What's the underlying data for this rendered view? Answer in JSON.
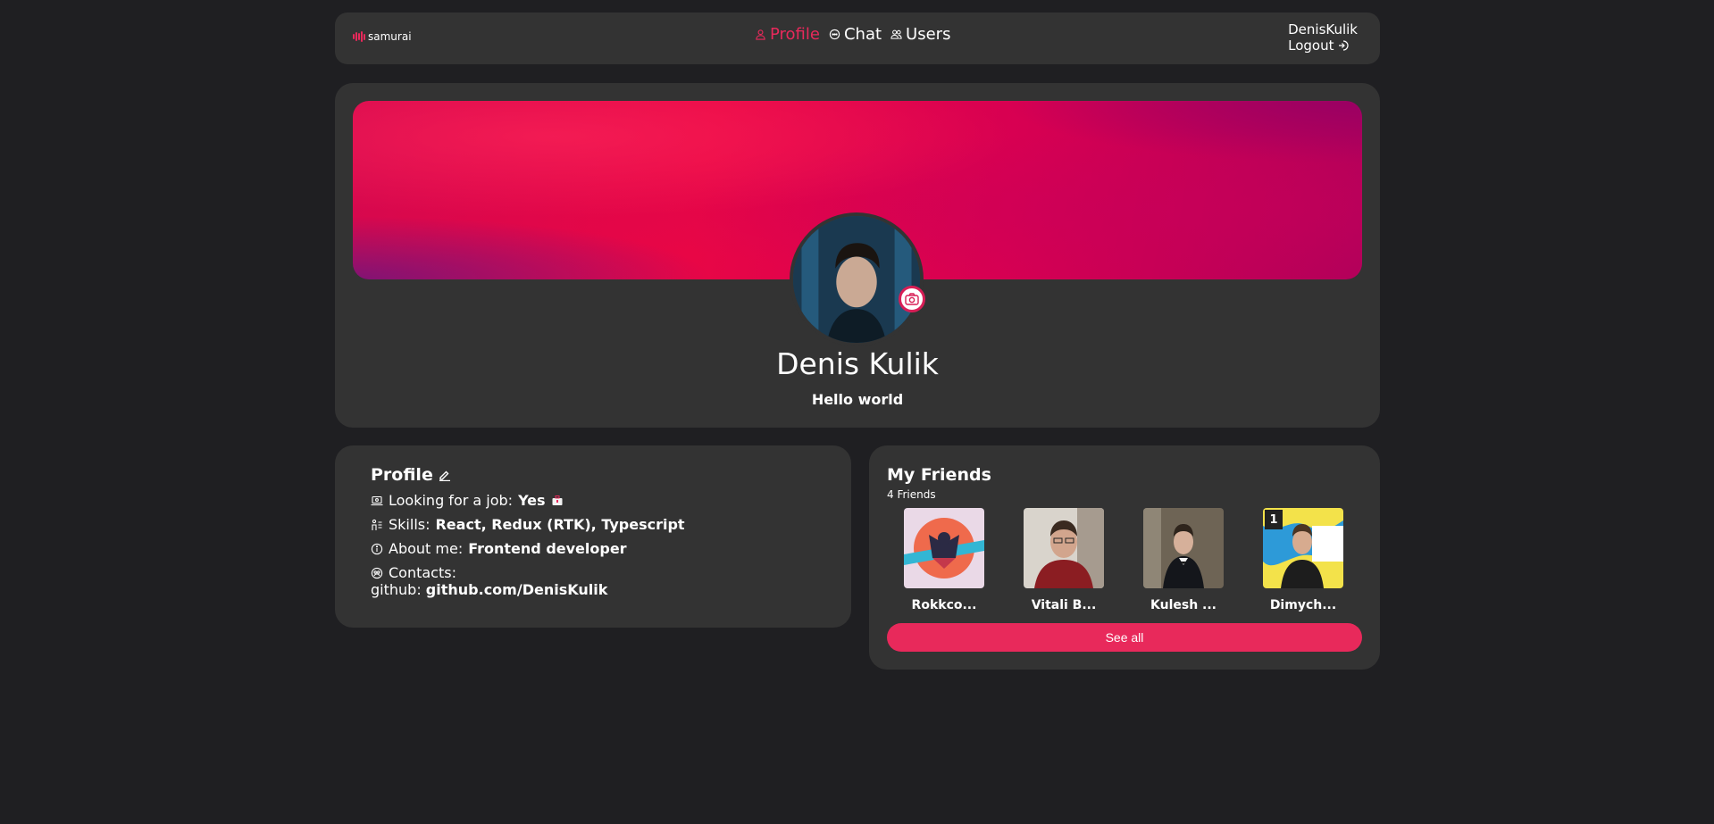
{
  "header": {
    "logo_text": "samurai",
    "nav": [
      {
        "label": "Profile",
        "icon": "user-icon",
        "active": true
      },
      {
        "label": "Chat",
        "icon": "chat-icon",
        "active": false
      },
      {
        "label": "Users",
        "icon": "users-icon",
        "active": false
      }
    ],
    "username": "DenisKulik",
    "logout_label": "Logout"
  },
  "profile": {
    "name": "Denis Kulik",
    "status": "Hello world"
  },
  "info": {
    "title": "Profile",
    "job_label": "Looking for a job:",
    "job_value": "Yes",
    "skills_label": "Skills:",
    "skills_value": "React, Redux (RTK), Typescript",
    "about_label": "About me:",
    "about_value": "Frontend developer",
    "contacts_label": "Contacts:",
    "github_label": "github:",
    "github_value": "github.com/DenisKulik"
  },
  "friends": {
    "title": "My Friends",
    "count": "4 Friends",
    "items": [
      {
        "name": "Rokkco..."
      },
      {
        "name": "Vitali B..."
      },
      {
        "name": "Kulesh ..."
      },
      {
        "name": "Dimych...",
        "badge": "1"
      }
    ],
    "see_all_label": "See all"
  },
  "colors": {
    "accent": "#e8295b",
    "background": "#1f1f22",
    "card": "#333333"
  }
}
